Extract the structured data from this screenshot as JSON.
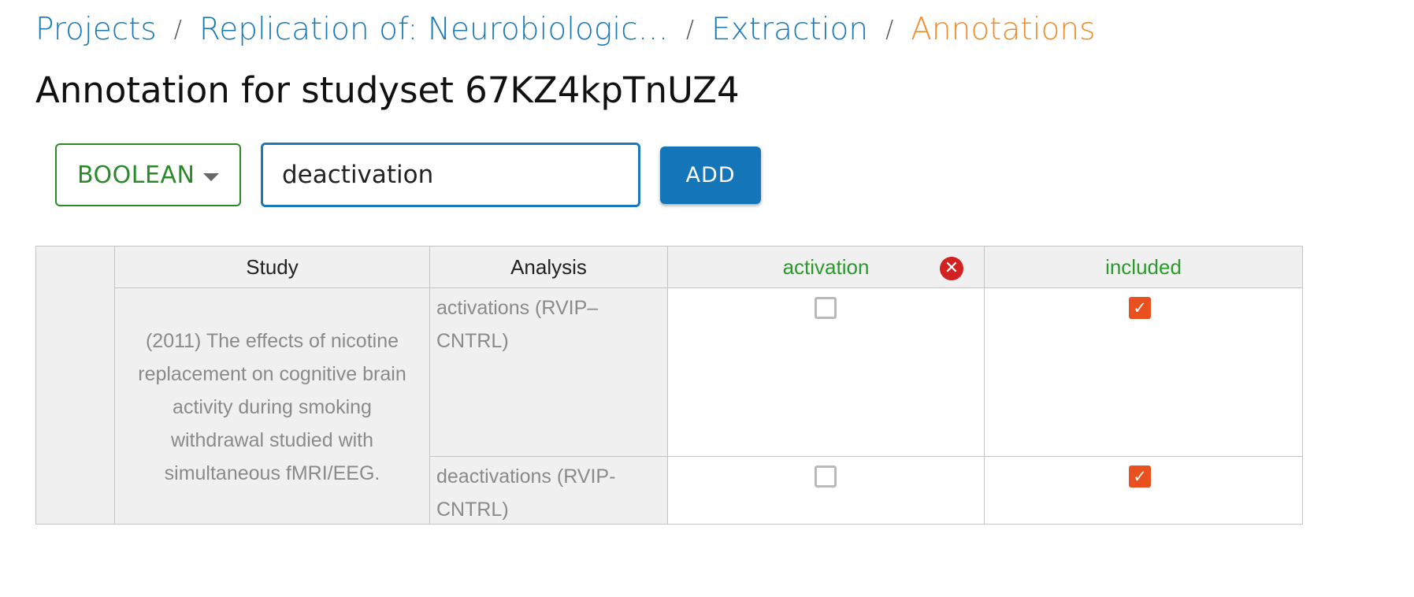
{
  "breadcrumb": {
    "items": [
      {
        "label": "Projects"
      },
      {
        "label": "Replication of: Neurobiological i..."
      },
      {
        "label": "Extraction"
      },
      {
        "label": "Annotations"
      }
    ],
    "separator": "/"
  },
  "page_title": "Annotation for studyset 67KZ4kpTnUZ4",
  "toolbar": {
    "type_select": {
      "value": "BOOLEAN"
    },
    "name_input": {
      "value": "deactivation",
      "placeholder": ""
    },
    "add_label": "ADD"
  },
  "table": {
    "headers": {
      "study": "Study",
      "analysis": "Analysis",
      "columns": [
        "activation",
        "included"
      ]
    },
    "study_title": "(2011) The effects of nicotine replacement on cognitive brain activity during smoking withdrawal studied with simultaneous fMRI/EEG.",
    "rows": [
      {
        "analysis": "activations (RVIP–CNTRL)",
        "activation": false,
        "included": true
      },
      {
        "analysis": "deactivations (RVIP-CNTRL)",
        "activation": false,
        "included": true
      }
    ]
  },
  "colors": {
    "link": "#1a7ab8",
    "current_crumb": "#f08c2a",
    "boolean_green": "#2a8a2a",
    "primary_button": "#1476b8",
    "checkbox_checked": "#e8501f",
    "remove_icon": "#d32020"
  },
  "icons": {
    "dropdown": "caret-down-icon",
    "remove_column": "close-circle-icon",
    "checked": "checkmark-icon"
  }
}
